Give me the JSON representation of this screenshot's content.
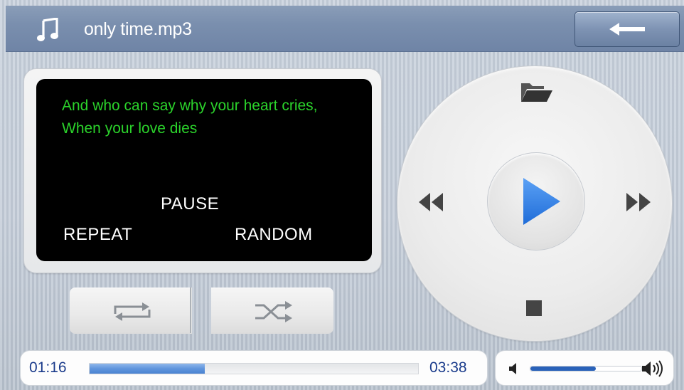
{
  "header": {
    "title": "only time.mp3",
    "music_icon": "music-note-icon",
    "back_icon": "back-arrow-icon"
  },
  "screen": {
    "lyrics": "And who can say why your heart cries, When your love dies",
    "status_state": "PAUSE",
    "repeat_label": "REPEAT",
    "random_label": "RANDOM"
  },
  "mode_buttons": {
    "repeat_icon": "repeat-icon",
    "shuffle_icon": "shuffle-icon"
  },
  "controls": {
    "open_icon": "folder-open-icon",
    "prev_icon": "rewind-icon",
    "play_icon": "play-icon",
    "next_icon": "fast-forward-icon",
    "stop_icon": "stop-icon"
  },
  "progress": {
    "elapsed": "01:16",
    "total": "03:38",
    "fraction": 0.35
  },
  "volume": {
    "level": 0.59,
    "low_icon": "volume-low-icon",
    "high_icon": "volume-high-icon"
  },
  "colors": {
    "lyrics": "#2bd32b",
    "play_accent": "#2a7be6",
    "time_text": "#1a3b8b",
    "progress_fill": "#5f95dd",
    "volume_fill": "#2a62b9"
  }
}
